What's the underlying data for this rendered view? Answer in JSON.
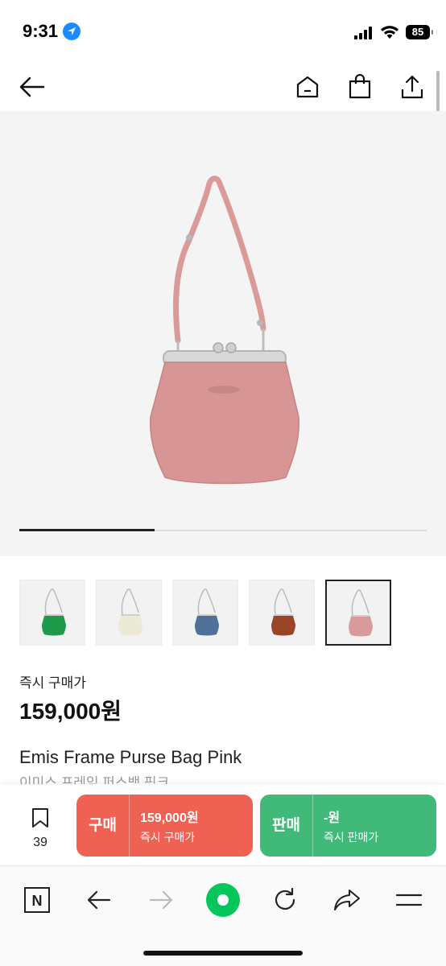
{
  "status_bar": {
    "time": "9:31",
    "battery": "85"
  },
  "top_nav": {
    "back_icon": "arrow-left-icon",
    "home_icon": "home-icon",
    "cart_icon": "shopping-bag-icon",
    "share_icon": "share-icon"
  },
  "gallery": {
    "current_slide": 1,
    "total_slides": 3,
    "progress": 0.333
  },
  "thumbnails": [
    {
      "color_name": "green",
      "color": "#1f9a4a"
    },
    {
      "color_name": "ivory",
      "color": "#ece9d6"
    },
    {
      "color_name": "blue",
      "color": "#4f7098"
    },
    {
      "color_name": "brown",
      "color": "#9a4428"
    },
    {
      "color_name": "pink",
      "color": "#d89a9a",
      "selected": true
    }
  ],
  "product": {
    "price_label": "즉시 구매가",
    "price": "159,000원",
    "name": "Emis Frame Purse Bag Pink",
    "name_ko": "이미스 프레임 퍼스백 핑크"
  },
  "buy_bar": {
    "bookmark_count": "39",
    "buy": {
      "label": "구매",
      "amount": "159,000원",
      "desc": "즉시 구매가",
      "color": "#ef6253"
    },
    "sell": {
      "label": "판매",
      "amount": "-원",
      "desc": "즉시 판매가",
      "color": "#41b979"
    }
  },
  "browser_bar": {
    "naver_label": "N",
    "accent": "#03c75a"
  }
}
